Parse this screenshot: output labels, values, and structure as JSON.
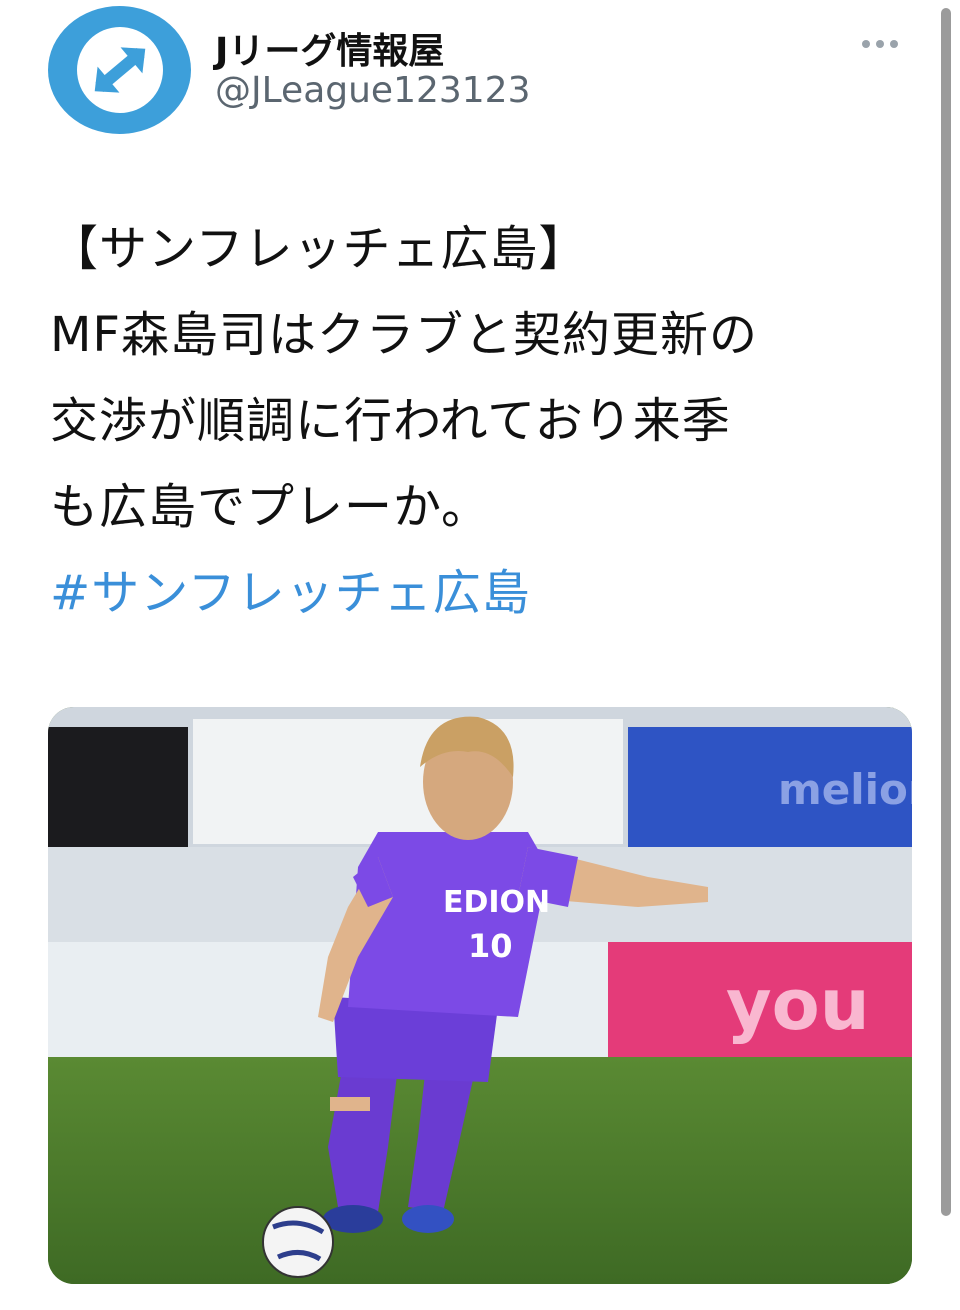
{
  "account": {
    "display_name": "Jリーグ情報屋",
    "handle": "@JLeague123123",
    "avatar_icon": "double-arrow-icon",
    "avatar_color": "#3d9fda"
  },
  "tweet": {
    "lines": [
      "【サンフレッチェ広島】",
      "MF森島司はクラブと契約更新の",
      "交渉が順調に行われており来季",
      "も広島でプレーか。"
    ],
    "hashtag": "#サンフレッチェ広島",
    "hashtag_color": "#3a8fd9"
  },
  "media": {
    "jersey_text": "EDION",
    "jersey_number": "10",
    "ad_right_top": "melior",
    "ad_right_bottom": "you"
  }
}
